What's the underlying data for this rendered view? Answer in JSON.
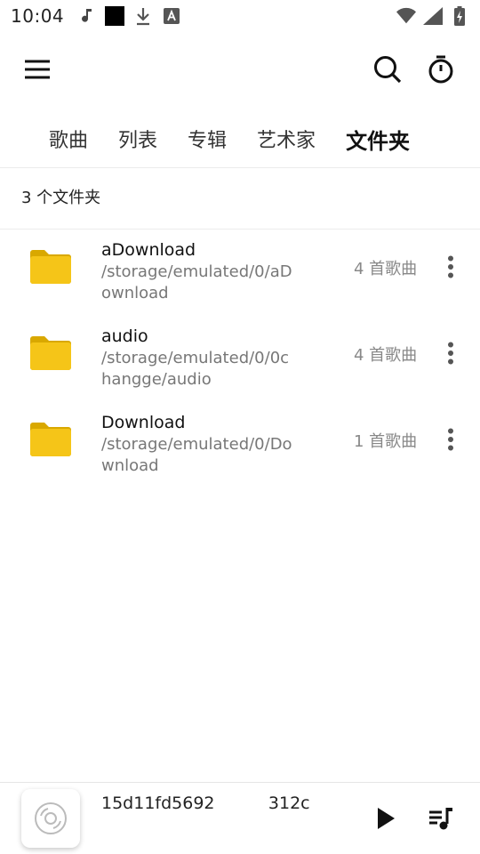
{
  "status_bar": {
    "time": "10:04",
    "left_icons": [
      "music-note-icon",
      "black-square-icon",
      "download-icon",
      "font-icon"
    ],
    "right_icons": [
      "wifi-icon",
      "signal-icon",
      "battery-charging-icon"
    ]
  },
  "app_bar": {
    "icons": [
      "menu-icon",
      "search-icon",
      "timer-icon"
    ]
  },
  "tabs": [
    {
      "label": "歌曲",
      "active": false
    },
    {
      "label": "列表",
      "active": false
    },
    {
      "label": "专辑",
      "active": false
    },
    {
      "label": "艺术家",
      "active": false
    },
    {
      "label": "文件夹",
      "active": true
    }
  ],
  "folder_count": "3 个文件夹",
  "folders": [
    {
      "name": "aDownload",
      "path": "/storage/emulated/0/aDownload",
      "song_count": "4 首歌曲"
    },
    {
      "name": "audio",
      "path": "/storage/emulated/0/0changge/audio",
      "song_count": "4 首歌曲"
    },
    {
      "name": "Download",
      "path": "/storage/emulated/0/Download",
      "song_count": "1 首歌曲"
    }
  ],
  "player": {
    "title": "15d11fd5692          312c",
    "icons": [
      "album-art-icon",
      "play-icon",
      "queue-icon"
    ]
  },
  "colors": {
    "folder": "#F5C518",
    "folder_tab": "#D9A800",
    "text_primary": "#111111",
    "text_secondary": "#777777"
  }
}
